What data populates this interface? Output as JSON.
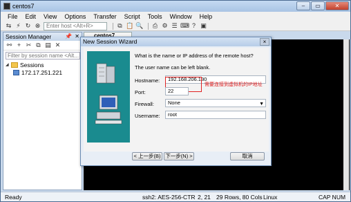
{
  "window": {
    "title": "centos7"
  },
  "menu": [
    "File",
    "Edit",
    "View",
    "Options",
    "Transfer",
    "Script",
    "Tools",
    "Window",
    "Help"
  ],
  "toolbar": {
    "host_placeholder": "Enter host <Alt+R>"
  },
  "session_panel": {
    "title": "Session Manager",
    "filter_placeholder": "Filter by session name <Alt...",
    "root": "Sessions",
    "items": [
      "172.17.251.221"
    ]
  },
  "terminal_tab": {
    "label": "centos7"
  },
  "dialog": {
    "title": "New Session Wizard",
    "close": "×",
    "prompt": "What is the name or IP address of the remote host?",
    "hint": "The user name can be left blank.",
    "annotation": "需要连接到虚拟机的IP地址",
    "fields": {
      "hostname_label": "Hostname:",
      "hostname_value": "192.168.206.130",
      "port_label": "Port:",
      "port_value": "22",
      "firewall_label": "Firewall:",
      "firewall_value": "None",
      "username_label": "Username:",
      "username_value": "root"
    },
    "buttons": {
      "back": "< 上一步(B)",
      "next": "下一步(N) >",
      "cancel": "取消"
    }
  },
  "status": {
    "ready": "Ready",
    "cipher": "ssh2: AES-256-CTR",
    "position": "2,  21",
    "size": "29 Rows, 80 Cols",
    "os": "Linux",
    "caps": "CAP NUM"
  }
}
